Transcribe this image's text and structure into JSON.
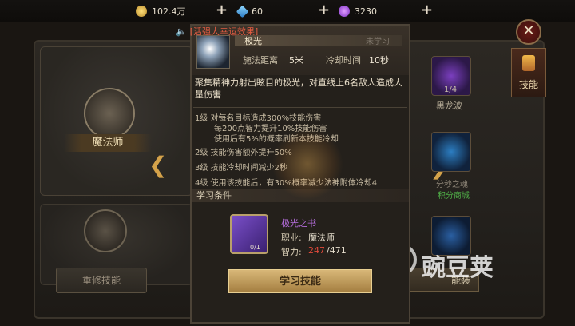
{
  "resources": {
    "gold": "102.4万",
    "diamond": "60",
    "gem": "3230",
    "plus": "+"
  },
  "colors": {
    "accent_gold": "#d4a24a",
    "warning_red": "#e35c42",
    "item_purple": "#b86ee0",
    "shop_green": "#4fae47"
  },
  "background": {
    "class_name": "魔法师",
    "redo_button": "重修技能",
    "right_button": "能装",
    "side_tab": "技能",
    "slot_count": "1/4",
    "slot_name": "黑龙波",
    "slot_name2": "分秒之魂",
    "slot_shop": "积分商城",
    "watermark": "豌豆荚"
  },
  "popup": {
    "buff": "[活强大幸运效果]",
    "skill_name": "极光",
    "status": "未学习",
    "range_label": "施法距离",
    "range_value": "5米",
    "cd_label": "冷却时间",
    "cd_value": "10秒",
    "description": "聚集精神力射出眩目的极光，对直线上6名敌人造成大量伤害",
    "levels": [
      "1级  对每名目标造成300%技能伤害",
      "每200点智力提升10%技能伤害",
      "使用后有5%的概率刷新本技能冷却",
      "2级  技能伤害额外提升50%",
      "3级  技能冷却时间减少2秒",
      "4级  使用该技能后，有30%概率减少法神附体冷却4"
    ],
    "condition_title": "学习条件",
    "book_name": "极光之书",
    "book_count": "0/1",
    "req_label": "职业:",
    "req_value": "魔法师",
    "stat_label": "智力:",
    "stat_current": "247",
    "stat_max": "/471",
    "learn_button": "学习技能"
  }
}
